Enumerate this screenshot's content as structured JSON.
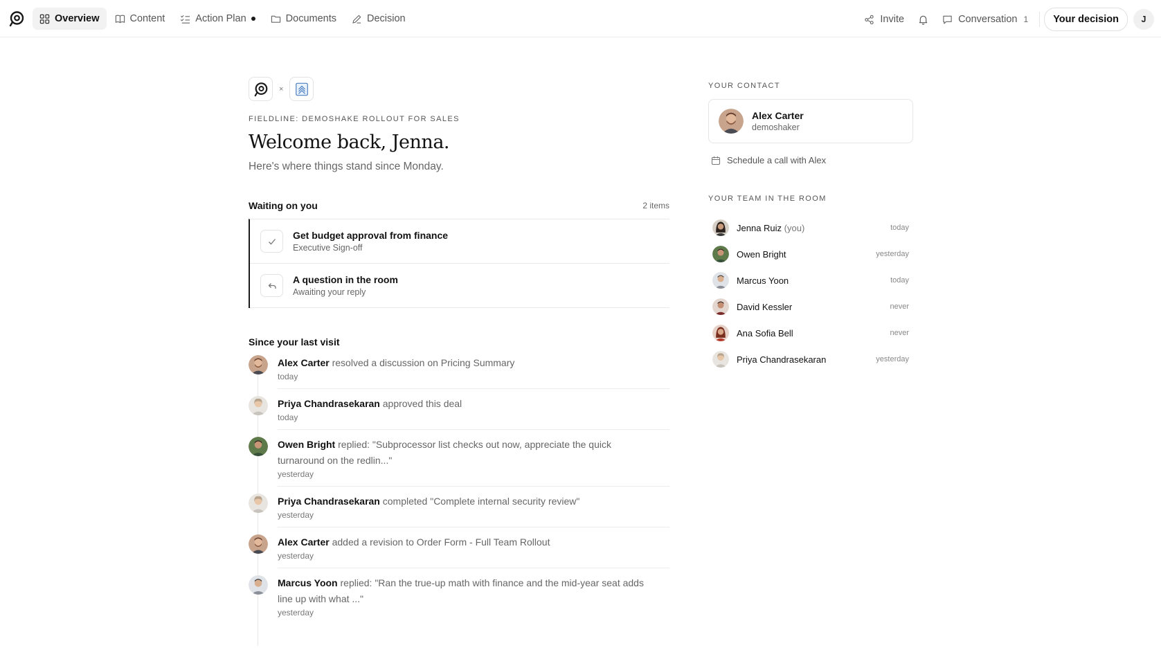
{
  "nav": {
    "items": [
      {
        "label": "Overview",
        "icon": "grid-icon",
        "active": true
      },
      {
        "label": "Content",
        "icon": "book-icon",
        "active": false
      },
      {
        "label": "Action Plan",
        "icon": "checklist-icon",
        "active": false,
        "has_dot": true
      },
      {
        "label": "Documents",
        "icon": "folder-icon",
        "active": false
      },
      {
        "label": "Decision",
        "icon": "pen-icon",
        "active": false
      }
    ]
  },
  "toolbar": {
    "invite_label": "Invite",
    "conversation_label": "Conversation",
    "conversation_count": "1",
    "decision_label": "Your decision",
    "user_initial": "J"
  },
  "main": {
    "brand_separator": "×",
    "eyebrow": "FIELDLINE: DEMOSHAKE ROLLOUT FOR SALES",
    "greeting": "Welcome back, Jenna.",
    "subtitle": "Here's where things stand since Monday.",
    "waiting": {
      "title": "Waiting on you",
      "count": "2 items",
      "items": [
        {
          "title": "Get budget approval from finance",
          "subtitle": "Executive Sign-off",
          "icon": "check-icon"
        },
        {
          "title": "A question in the room",
          "subtitle": "Awaiting your reply",
          "icon": "reply-icon"
        }
      ]
    },
    "since": {
      "title": "Since your last visit",
      "items": [
        {
          "who": "Alex Carter",
          "text": " resolved a discussion on Pricing Summary",
          "time": "today"
        },
        {
          "who": "Priya Chandrasekaran",
          "text": " approved this deal",
          "time": "today"
        },
        {
          "who": "Owen Bright",
          "text": " replied: \"Subprocessor list checks out now, appreciate the quick turnaround on the redlin...\"",
          "time": "yesterday"
        },
        {
          "who": "Priya Chandrasekaran",
          "text": " completed \"Complete internal security review\"",
          "time": "yesterday"
        },
        {
          "who": "Alex Carter",
          "text": " added a revision to Order Form - Full Team Rollout",
          "time": "yesterday"
        },
        {
          "who": "Marcus Yoon",
          "text": " replied: \"Ran the true-up math with finance and the mid-year seat adds line up with what ...\"",
          "time": "yesterday"
        }
      ]
    }
  },
  "side": {
    "contact_eyebrow": "YOUR CONTACT",
    "contact": {
      "name": "Alex Carter",
      "org": "demoshaker"
    },
    "schedule_label": "Schedule a call with Alex",
    "team_eyebrow": "YOUR TEAM IN THE ROOM",
    "team": [
      {
        "name": "Jenna Ruiz",
        "suffix": " (you)",
        "seen": "today"
      },
      {
        "name": "Owen Bright",
        "suffix": "",
        "seen": "yesterday"
      },
      {
        "name": "Marcus Yoon",
        "suffix": "",
        "seen": "today"
      },
      {
        "name": "David Kessler",
        "suffix": "",
        "seen": "never"
      },
      {
        "name": "Ana Sofia Bell",
        "suffix": "",
        "seen": "never"
      },
      {
        "name": "Priya Chandrasekaran",
        "suffix": "",
        "seen": "yesterday"
      }
    ]
  },
  "colors": {
    "accent_dark": "#1a1a1a",
    "muted_text": "#666666",
    "border": "#e8e8e8",
    "partner_logo_blue": "#4a7fc1"
  }
}
